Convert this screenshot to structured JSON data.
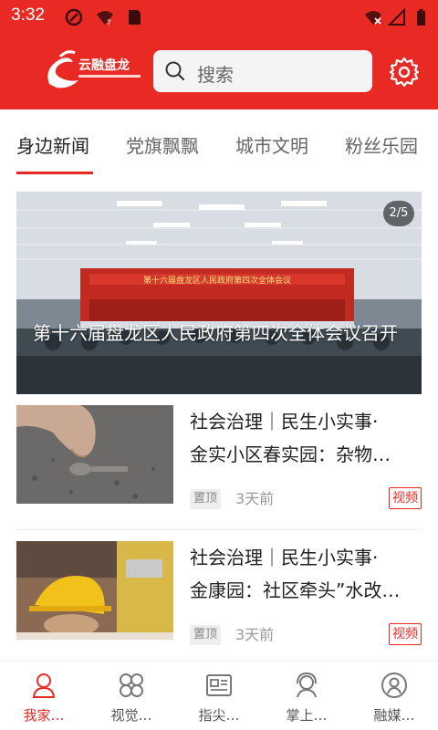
{
  "status": {
    "time": "3:32"
  },
  "header": {
    "logo_text": "云融盘龙",
    "search_placeholder": "搜索"
  },
  "tabs": [
    {
      "label": "身边新闻",
      "active": true
    },
    {
      "label": "党旗飘飘"
    },
    {
      "label": "城市文明"
    },
    {
      "label": "粉丝乐园"
    }
  ],
  "hero": {
    "badge": "2/5",
    "banner_text": "第十六届盘龙区人民政府第四次全体会议",
    "title": "第十六届盘龙区人民政府第四次全体会议召开"
  },
  "news": [
    {
      "title_line1": "社会治理｜民生小实事·",
      "title_line2": "金实小区春实园：杂物…",
      "tag": "置顶",
      "time": "3天前",
      "media": "视频"
    },
    {
      "title_line1": "社会治理｜民生小实事·",
      "title_line2": "金康园：社区牵头”水改…",
      "tag": "置顶",
      "time": "3天前",
      "media": "视频"
    }
  ],
  "bottom_nav": [
    {
      "label": "我家…",
      "icon": "person-icon",
      "active": true
    },
    {
      "label": "视觉…",
      "icon": "grid-icon"
    },
    {
      "label": "指尖…",
      "icon": "newspaper-icon"
    },
    {
      "label": "掌上…",
      "icon": "headset-icon"
    },
    {
      "label": "融媒…",
      "icon": "profile-icon"
    }
  ],
  "colors": {
    "brand": "#e92a24"
  }
}
